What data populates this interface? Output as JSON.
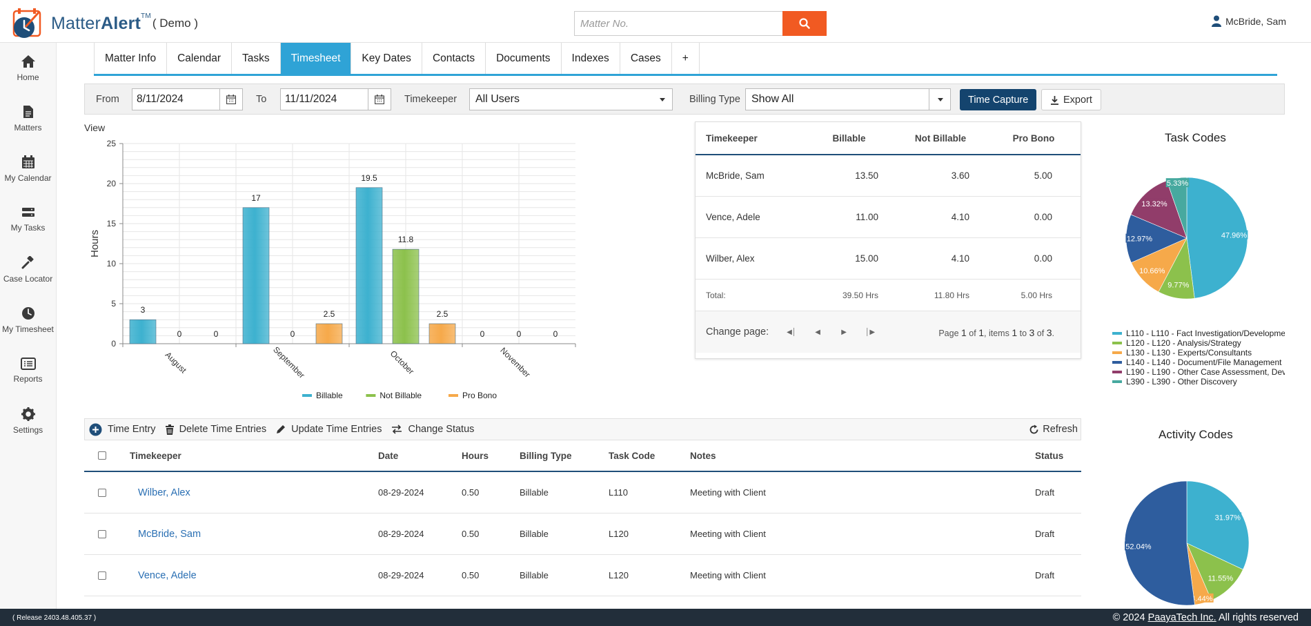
{
  "brand": {
    "name_light": "Matter",
    "name_bold": "Alert",
    "tm": "TM",
    "demo": "( Demo )"
  },
  "search": {
    "placeholder": "Matter No."
  },
  "user": {
    "name": "McBride, Sam"
  },
  "sidebar": {
    "items": [
      {
        "label": "Home",
        "icon": "home-icon"
      },
      {
        "label": "Matters",
        "icon": "document-icon"
      },
      {
        "label": "My Calendar",
        "icon": "calendar-icon"
      },
      {
        "label": "My Tasks",
        "icon": "tasks-icon"
      },
      {
        "label": "Case Locator",
        "icon": "gavel-icon"
      },
      {
        "label": "My Timesheet",
        "icon": "clock-icon"
      },
      {
        "label": "Reports",
        "icon": "reports-icon"
      },
      {
        "label": "Settings",
        "icon": "gear-icon"
      }
    ]
  },
  "tabs": {
    "items": [
      "Matter Info",
      "Calendar",
      "Tasks",
      "Timesheet",
      "Key Dates",
      "Contacts",
      "Documents",
      "Indexes",
      "Cases",
      "+"
    ],
    "active": "Timesheet"
  },
  "filter": {
    "from_label": "From",
    "from_value": "8/11/2024",
    "to_label": "To",
    "to_value": "11/11/2024",
    "timekeeper_label": "Timekeeper",
    "timekeeper_value": "All Users",
    "billing_label": "Billing Type",
    "billing_value": "Show All",
    "capture_label": "Time Capture",
    "export_label": "Export"
  },
  "view_label": "View",
  "chart_data": [
    {
      "type": "bar",
      "ylabel": "Hours",
      "categories": [
        "August",
        "September",
        "October",
        "November"
      ],
      "ylim": [
        0,
        25
      ],
      "yticks": [
        0,
        5,
        10,
        15,
        20,
        25
      ],
      "series": [
        {
          "name": "Billable",
          "color": "#3db1cf",
          "values": [
            3,
            17,
            19.5,
            0
          ]
        },
        {
          "name": "Not Billable",
          "color": "#8cc14c",
          "values": [
            0,
            0,
            11.8,
            0
          ]
        },
        {
          "name": "Pro Bono",
          "color": "#f6a94a",
          "values": [
            0,
            2.5,
            2.5,
            0
          ]
        }
      ],
      "legend": "bottom",
      "grid": true
    },
    {
      "type": "pie",
      "title": "Task Codes",
      "slices": [
        {
          "label": "L110 - L110 - Fact Investigation/Developme",
          "value": 47.96,
          "text": "47.96%",
          "color": "#3db1cf"
        },
        {
          "label": "L120 - L120 - Analysis/Strategy",
          "value": 9.77,
          "text": "9.77%",
          "color": "#8cc14c"
        },
        {
          "label": "L130 - L130 - Experts/Consultants",
          "value": 10.66,
          "text": "10.66%",
          "color": "#f6a94a"
        },
        {
          "label": "L140 - L140 - Document/File Management",
          "value": 12.97,
          "text": "12.97%",
          "color": "#2e5d9e"
        },
        {
          "label": "L190 - L190 - Other Case Assessment, Dev",
          "value": 13.32,
          "text": "13.32%",
          "color": "#913d6a"
        },
        {
          "label": "L390 - L390 - Other Discovery",
          "value": 5.33,
          "text": "5.33%",
          "color": "#47a99f"
        }
      ]
    },
    {
      "type": "pie",
      "title": "Activity Codes",
      "slices": [
        {
          "value": 31.97,
          "text": "31.97%",
          "color": "#3db1cf"
        },
        {
          "value": 11.55,
          "text": "11.55%",
          "color": "#8cc14c"
        },
        {
          "value": 4.44,
          "text": "4.44%",
          "color": "#f6a94a"
        },
        {
          "value": 52.04,
          "text": "52.04%",
          "color": "#2e5d9e"
        }
      ]
    }
  ],
  "summary": {
    "headers": [
      "Timekeeper",
      "Billable",
      "Not Billable",
      "Pro Bono"
    ],
    "rows": [
      [
        "McBride, Sam",
        "13.50",
        "3.60",
        "5.00"
      ],
      [
        "Vence, Adele",
        "11.00",
        "4.10",
        "0.00"
      ],
      [
        "Wilber, Alex",
        "15.00",
        "4.10",
        "0.00"
      ]
    ],
    "total": [
      "Total:",
      "39.50 Hrs",
      "11.80 Hrs",
      "5.00 Hrs"
    ],
    "pager": {
      "change_label": "Change page:",
      "text_page": "Page",
      "page": "1",
      "text_of": "of",
      "pages": "1",
      "text_items": ", items",
      "from": "1",
      "text_to": "to",
      "to": "3",
      "text_of2": "of",
      "total": "3",
      "end": "."
    }
  },
  "toolbar": {
    "time_entry": "Time Entry",
    "delete": "Delete Time Entries",
    "update": "Update Time Entries",
    "change_status": "Change Status",
    "refresh": "Refresh"
  },
  "table": {
    "headers": [
      "Timekeeper",
      "Date",
      "Hours",
      "Billing Type",
      "Task Code",
      "Notes",
      "Status"
    ],
    "rows": [
      [
        "Wilber, Alex",
        "08-29-2024",
        "0.50",
        "Billable",
        "L110",
        "Meeting with Client",
        "Draft"
      ],
      [
        "McBride, Sam",
        "08-29-2024",
        "0.50",
        "Billable",
        "L120",
        "Meeting with Client",
        "Draft"
      ],
      [
        "Vence, Adele",
        "08-29-2024",
        "0.50",
        "Billable",
        "L120",
        "Meeting with Client",
        "Draft"
      ]
    ]
  },
  "footer": {
    "release": "( Release 2403.48.405.37 )",
    "copy_pre": "© 2024 ",
    "copy_link": "PaayaTech Inc.",
    "copy_post": " All rights reserved"
  }
}
